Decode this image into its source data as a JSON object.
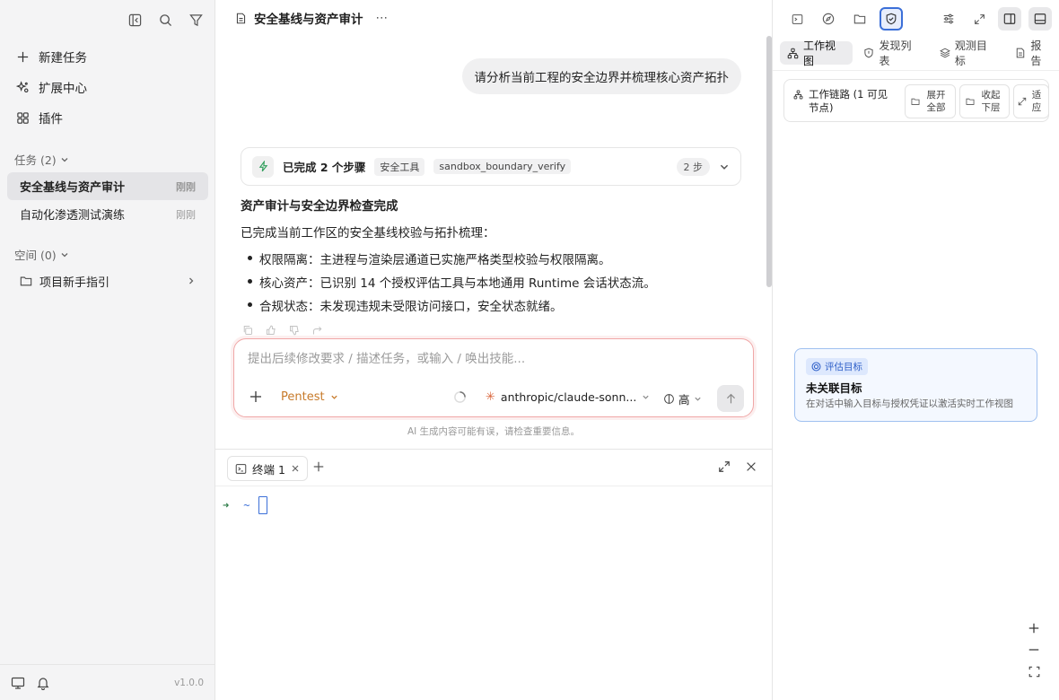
{
  "sidebar": {
    "nav": [
      {
        "label": "新建任务",
        "icon": "plus-icon"
      },
      {
        "label": "扩展中心",
        "icon": "sparkles-icon"
      },
      {
        "label": "插件",
        "icon": "puzzle-icon"
      }
    ],
    "tasks_header": "任务 (2)",
    "tasks": [
      {
        "label": "安全基线与资产审计",
        "time": "刚刚"
      },
      {
        "label": "自动化渗透测试演练",
        "time": "刚刚"
      }
    ],
    "spaces_header": "空间 (0)",
    "space_item": "项目新手指引",
    "version": "v1.0.0"
  },
  "main": {
    "title": "安全基线与资产审计",
    "user_message": "请分析当前工程的安全边界并梳理核心资产拓扑",
    "steps": {
      "title": "已完成 2 个步骤",
      "chip1": "安全工具",
      "chip2": "sandbox_boundary_verify",
      "count": "2 步"
    },
    "answer": {
      "heading": "资产审计与安全边界检查完成",
      "intro": "已完成当前工作区的安全基线校验与拓扑梳理：",
      "bullets": [
        "权限隔离：主进程与渲染层通道已实施严格类型校验与权限隔离。",
        "核心资产：已识别 14 个授权评估工具与本地通用 Runtime 会话状态流。",
        "合规状态：未发现违规未受限访问接口，安全状态就绪。"
      ]
    },
    "composer": {
      "placeholder": "提出后续修改要求 / 描述任务，或输入 / 唤出技能...",
      "mode": "Pentest",
      "model": "anthropic/claude-sonn...",
      "effort": "高"
    },
    "disclaimer": "AI 生成内容可能有误，请检查重要信息。"
  },
  "terminal": {
    "tab_label": "终端 1",
    "prompt_arrow": "➜",
    "prompt_dir": "~"
  },
  "panel": {
    "tabs": [
      {
        "label": "工作视图",
        "icon": "graph-icon"
      },
      {
        "label": "发现列表",
        "icon": "shield-icon"
      },
      {
        "label": "观测目标",
        "icon": "layers-icon"
      },
      {
        "label": "报告",
        "icon": "document-icon"
      }
    ],
    "work_chain": "工作链路 (1 可见节点)",
    "expand_all": "展开全部",
    "collapse": "收起下层",
    "fit": "适应",
    "target": {
      "badge": "评估目标",
      "title": "未关联目标",
      "subtitle": "在对话中输入目标与授权凭证以激活实时工作视图"
    }
  },
  "colors": {
    "accent_blue": "#3b6fd8",
    "mode_orange": "#c77a2a",
    "composer_border": "#f0a7a7",
    "claude_brand": "#d9643a"
  }
}
